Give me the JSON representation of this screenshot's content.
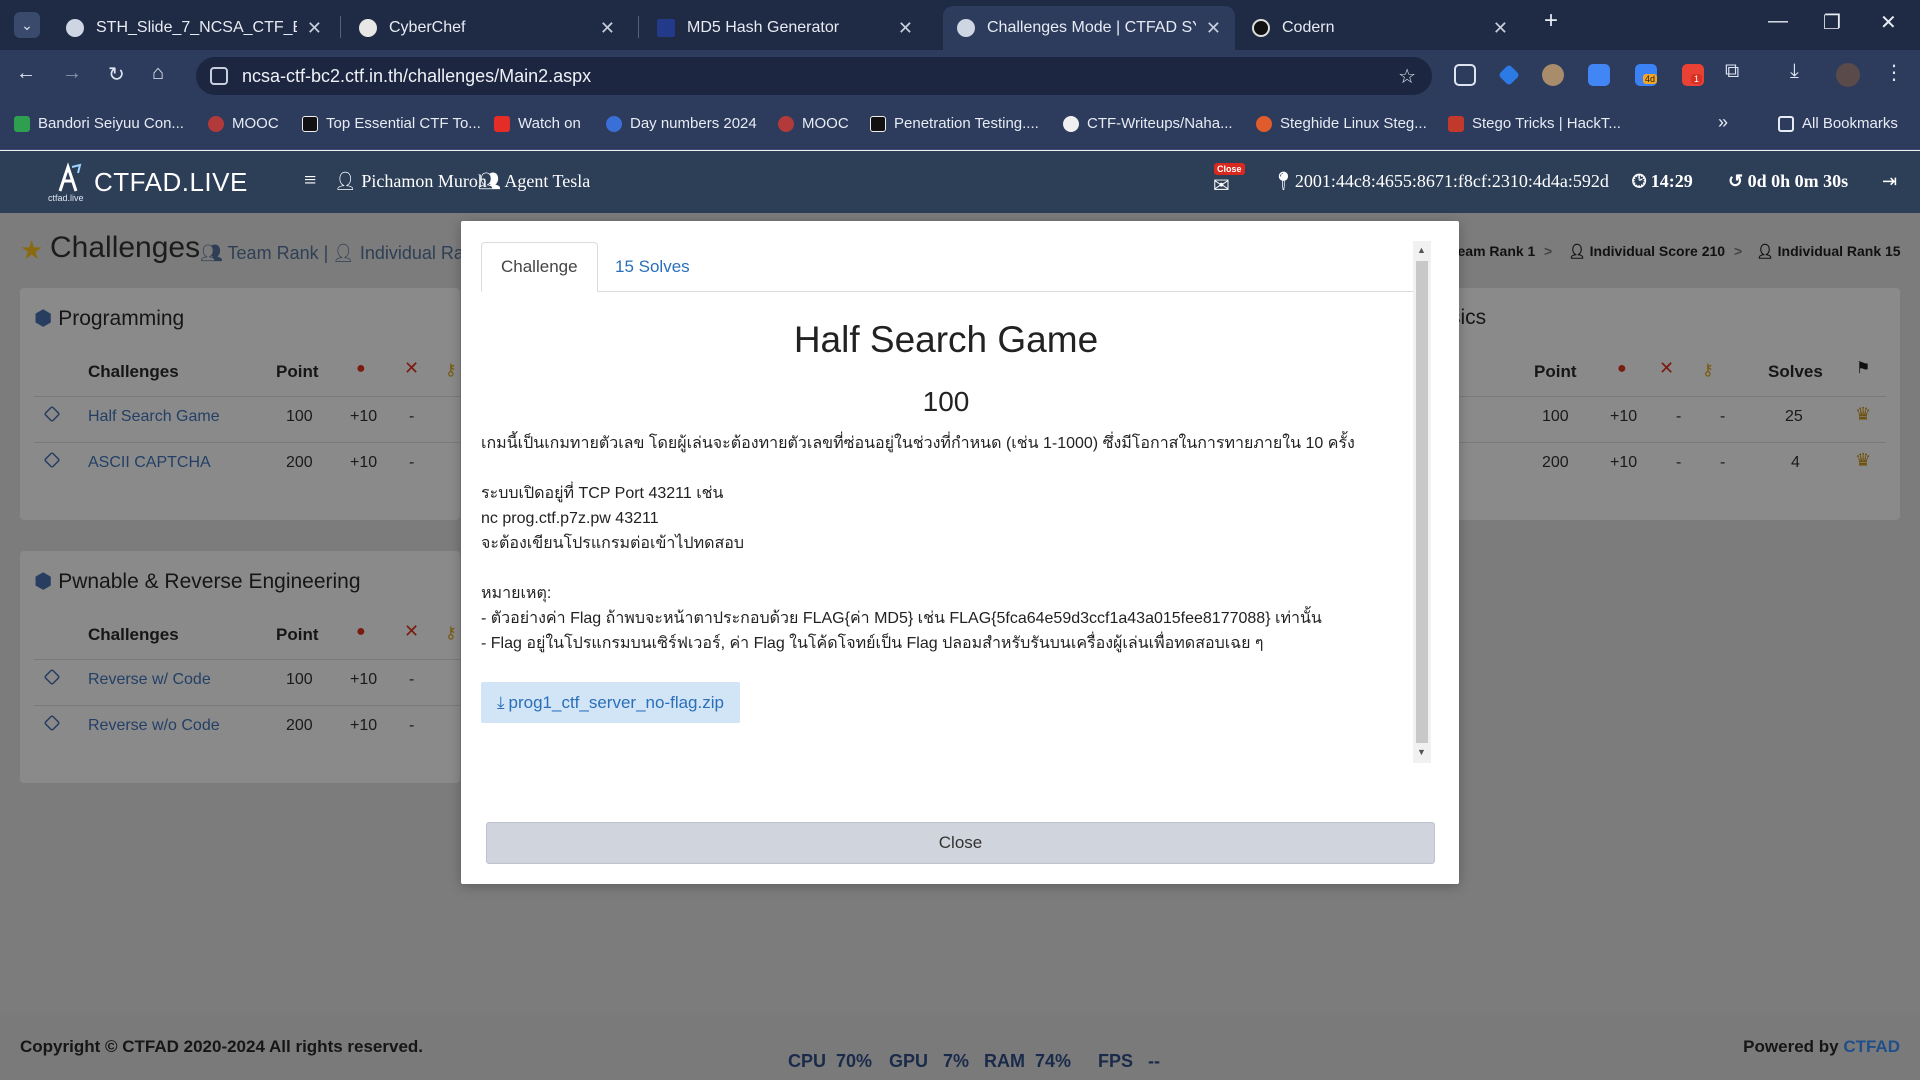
{
  "browser": {
    "tabs": [
      {
        "title": "STH_Slide_7_NCSA_CTF_Bootca"
      },
      {
        "title": "CyberChef"
      },
      {
        "title": "MD5 Hash Generator"
      },
      {
        "title": "Challenges Mode | CTFAD SYST"
      },
      {
        "title": "Codern"
      }
    ],
    "url": "ncsa-ctf-bc2.ctf.in.th/challenges/Main2.aspx",
    "bookmarks": [
      "Bandori Seiyuu Con...",
      "MOOC",
      "Top Essential CTF To...",
      "Watch on",
      "Day numbers 2024",
      "MOOC",
      "Penetration Testing....",
      "CTF-Writeups/Naha...",
      "Steghide Linux Steg...",
      "Stego Tricks | HackT..."
    ],
    "all_bookmarks": "All Bookmarks",
    "ext_badge_1": "4d",
    "ext_badge_2": "1"
  },
  "header": {
    "logo_sub": "ctfad.live",
    "brand": "CTFAD.LIVE",
    "user": "Pichamon Muroh",
    "team": "Agent Tesla",
    "close_badge": "Close",
    "ip": "2001:44c8:4655:8671:f8cf:2310:4d4a:592d",
    "time": "14:29",
    "countdown": "0d 0h 0m 30s"
  },
  "page": {
    "title": "Challenges",
    "team_rank_link": "Team Rank",
    "individual_link": "Individual Ra",
    "crumbs": [
      "Team Rank 1",
      "Individual Score 210",
      "Individual Rank 15"
    ],
    "panel1": {
      "title": "Programming",
      "col_challenges": "Challenges",
      "col_point": "Point",
      "rows": [
        {
          "name": "Half Search Game",
          "point": "100",
          "bonus": "+10",
          "a": "-"
        },
        {
          "name": "ASCII CAPTCHA",
          "point": "200",
          "bonus": "+10",
          "a": "-"
        }
      ]
    },
    "panel2": {
      "title": "Pwnable & Reverse Engineering",
      "col_challenges": "Challenges",
      "col_point": "Point",
      "rows": [
        {
          "name": "Reverse w/ Code",
          "point": "100",
          "bonus": "+10",
          "a": "-"
        },
        {
          "name": "Reverse w/o Code",
          "point": "200",
          "bonus": "+10",
          "a": "-"
        }
      ]
    },
    "panel3": {
      "title_fragment": "sics",
      "col_point": "Point",
      "col_solves": "Solves",
      "rows": [
        {
          "name_fragment": "",
          "point": "100",
          "bonus": "+10",
          "a": "-",
          "b": "-",
          "solves": "25"
        },
        {
          "name_fragment": "c",
          "point": "200",
          "bonus": "+10",
          "a": "-",
          "b": "-",
          "solves": "4"
        }
      ]
    }
  },
  "modal": {
    "tab_challenge": "Challenge",
    "tab_solves": "15 Solves",
    "title": "Half Search Game",
    "points": "100",
    "desc_lines": [
      "เกมนี้เป็นเกมทายตัวเลข โดยผู้เล่นจะต้องทายตัวเลขที่ซ่อนอยู่ในช่วงที่กำหนด (เช่น 1-1000) ซึ่งมีโอกาสในการทายภายใน 10 ครั้ง",
      "",
      "ระบบเปิดอยู่ที่ TCP Port 43211 เช่น",
      "nc prog.ctf.p7z.pw 43211",
      "จะต้องเขียนโปรแกรมต่อเข้าไปทดสอบ",
      "",
      "หมายเหตุ:",
      "- ตัวอย่างค่า Flag ถ้าพบจะหน้าตาประกอบด้วย FLAG{ค่า MD5} เช่น FLAG{5fca64e59d3ccf1a43a015fee8177088} เท่านั้น",
      "- Flag อยู่ในโปรแกรมบนเซิร์ฟเวอร์, ค่า Flag ในโค้ดโจทย์เป็น Flag ปลอมสำหรับรันบนเครื่องผู้เล่นเพื่อทดสอบเฉย ๆ"
    ],
    "download": "prog1_ctf_server_no-flag.zip",
    "close": "Close"
  },
  "footer": {
    "copyright": "Copyright © CTFAD 2020-2024 All rights reserved.",
    "powered_by": "Powered by",
    "powered_brand": "CTFAD",
    "cpu_label": "CPU",
    "cpu": "70%",
    "gpu_label": "GPU",
    "gpu": "7%",
    "ram_label": "RAM",
    "ram": "74%",
    "fps_label": "FPS",
    "fps": "--"
  }
}
